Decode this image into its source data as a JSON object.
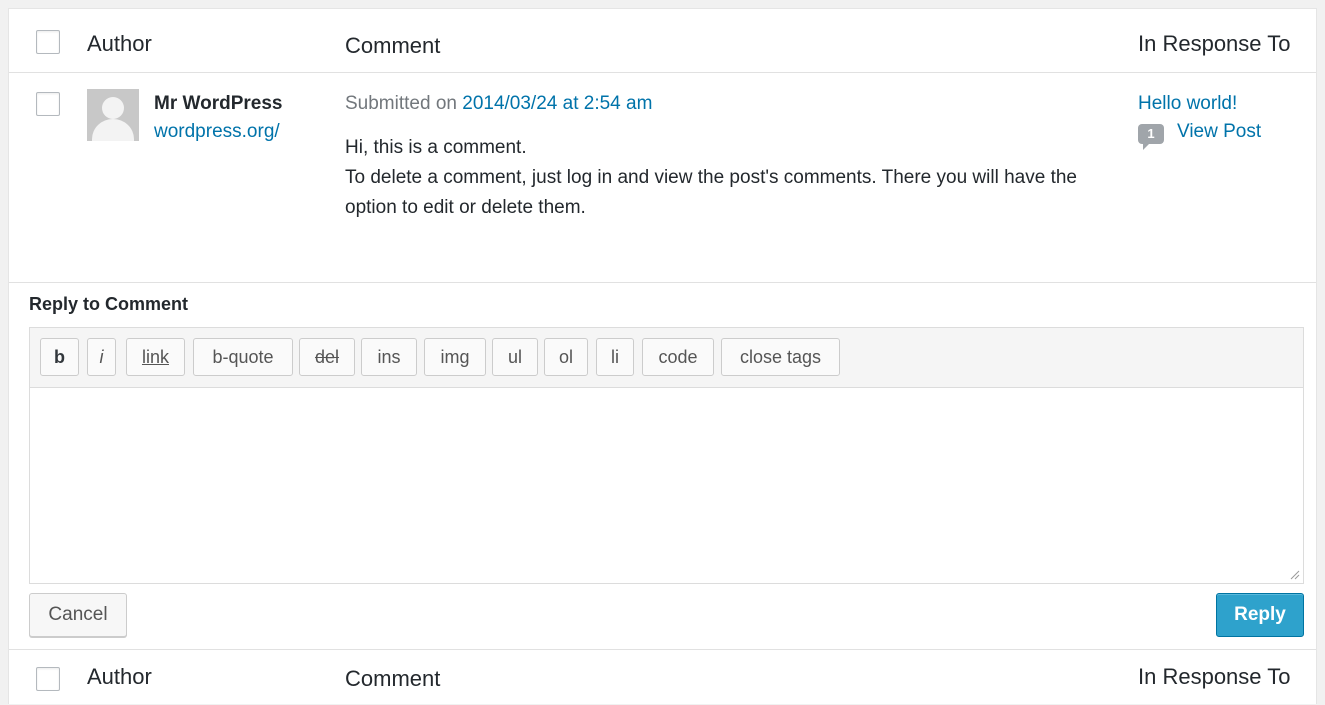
{
  "columns": {
    "author": "Author",
    "comment": "Comment",
    "in_response_to": "In Response To"
  },
  "comment": {
    "author_name": "Mr WordPress",
    "author_url": "wordpress.org/",
    "submitted_prefix": "Submitted on",
    "submitted_date": "2014/03/24 at 2:54 am",
    "body_line1": "Hi, this is a comment.",
    "body_line2": "To delete a comment, just log in and view the post's comments. There you will have the option to edit or delete them."
  },
  "response": {
    "post_title": "Hello world!",
    "comment_count": "1",
    "view_post": "View Post"
  },
  "reply": {
    "heading": "Reply to Comment",
    "quicktags": [
      "b",
      "i",
      "link",
      "b-quote",
      "del",
      "ins",
      "img",
      "ul",
      "ol",
      "li",
      "code",
      "close tags"
    ],
    "textarea_value": "",
    "cancel_label": "Cancel",
    "reply_label": "Reply"
  },
  "colors": {
    "link": "#0073aa",
    "primary_button": "#2ea2cc"
  }
}
